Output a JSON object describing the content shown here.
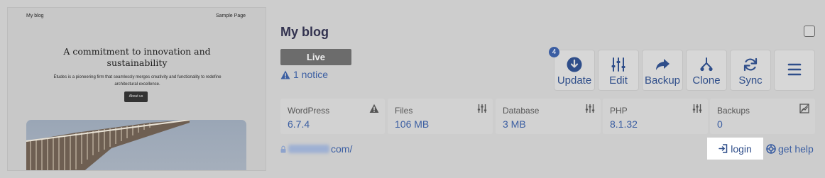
{
  "preview": {
    "site_title": "My blog",
    "nav_item": "Sample Page",
    "headline": "A commitment to innovation and sustainability",
    "body": "Études is a pioneering firm that seamlessly merges creativity and functionality to redefine architectural excellence.",
    "button_label": "About us"
  },
  "site": {
    "title": "My blog",
    "status": "Live",
    "notice": "1 notice",
    "url_suffix": "com/"
  },
  "actions": {
    "update_count": "4",
    "update": "Update",
    "edit": "Edit",
    "backup": "Backup",
    "clone": "Clone",
    "sync": "Sync"
  },
  "stats": [
    {
      "label": "WordPress",
      "value": "6.7.4",
      "icon": "warning-icon"
    },
    {
      "label": "Files",
      "value": "106 MB",
      "icon": "sliders-icon"
    },
    {
      "label": "Database",
      "value": "3 MB",
      "icon": "sliders-icon"
    },
    {
      "label": "PHP",
      "value": "8.1.32",
      "icon": "sliders-icon"
    },
    {
      "label": "Backups",
      "value": "0",
      "icon": "chart-icon"
    }
  ],
  "links": {
    "login": "login",
    "help": "get help"
  },
  "colors": {
    "accent": "#3b5ea2",
    "status_badge": "#6c6c6c",
    "background": "#cdcdcd"
  }
}
